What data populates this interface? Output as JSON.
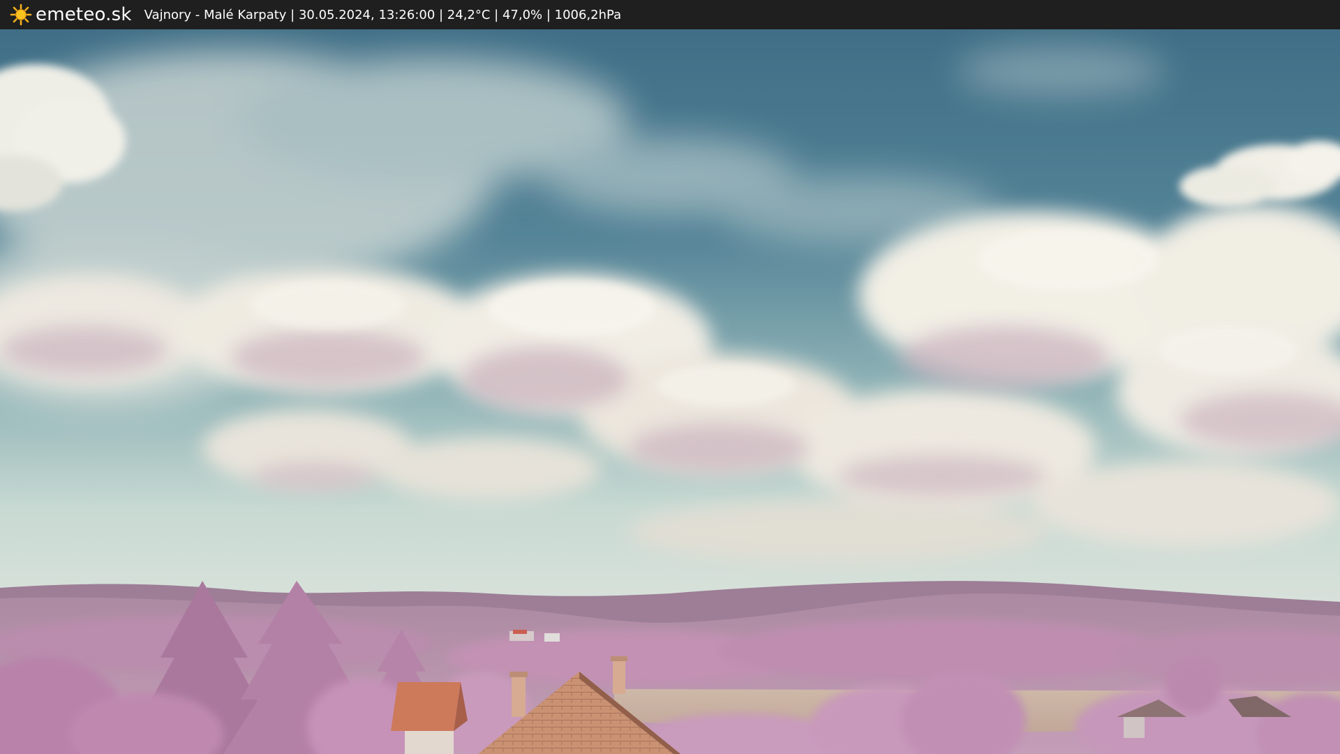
{
  "header": {
    "brand_icon": "sun-icon",
    "brand_name": "emeteo.sk",
    "location": "Vajnory - Malé Karpaty",
    "datetime": "30.05.2024, 13:26:00",
    "temperature": "24,2°C",
    "humidity": "47,0%",
    "pressure": "1006,2hPa",
    "info_line": "Vajnory - Malé Karpaty | 30.05.2024, 13:26:00 | 24,2°C | 47,0% | 1006,2hPa"
  },
  "colors": {
    "bar_bg": "#1f1f1f",
    "sky_top": "#3d6e86",
    "sky_horizon": "#b9d2cf",
    "cloud": "#efede4",
    "cloud_shade": "#cdb8c2",
    "hills": "#b48fa9",
    "foliage": "#c48fb8",
    "field": "#c9b2a2",
    "roof": "#cc7656"
  }
}
